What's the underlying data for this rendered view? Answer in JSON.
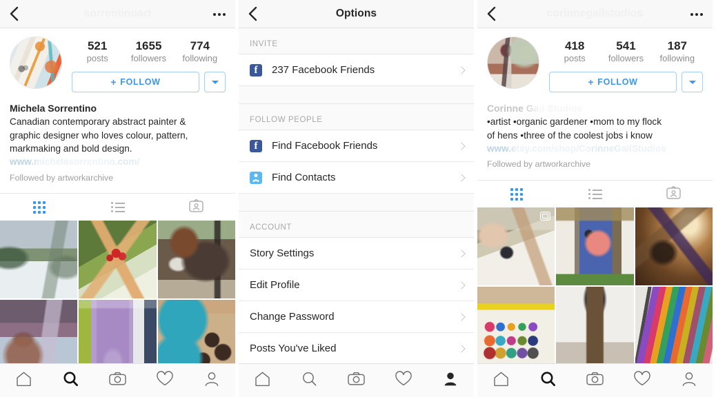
{
  "panels": {
    "left_profile": {
      "nav": {
        "back_icon": "back-chevron-icon",
        "username": "sorrentinoart",
        "username_visible_prefix": "sorre",
        "username_visible_suffix": "rt",
        "more_icon": "more-options-icon"
      },
      "avatar": "profile-avatar-abstract-painting",
      "stats": [
        {
          "num": "521",
          "label": "posts"
        },
        {
          "num": "1655",
          "label": "followers"
        },
        {
          "num": "774",
          "label": "following"
        }
      ],
      "follow_button": "FOLLOW",
      "follow_plus": "+",
      "dropdown_icon": "chevron-down-icon",
      "full_name": "Michela Sorrentino",
      "bio": "Canadian contemporary abstract painter &\ngraphic designer who loves colour, pattern,\nmarkmaking and bold design.",
      "website": "www.michelasorrentino.com/",
      "website_visible_prefix": "www",
      "website_visible_suffix": ".com/",
      "followed_by": "Followed by artworkarchive",
      "tabs": [
        {
          "name": "grid-tab",
          "icon": "grid-icon",
          "active": true
        },
        {
          "name": "list-tab",
          "icon": "list-icon",
          "active": false
        },
        {
          "name": "tagged-tab",
          "icon": "tagged-photos-icon",
          "active": false
        }
      ],
      "photos": [
        "snowy-forest-landscape",
        "holly-berries-on-plate",
        "horse-in-blanket",
        "winter-sunset-scene",
        "framed-artwork-by-door",
        "chocolate-cupcakes-on-teal-plates"
      ],
      "bottom_nav": [
        {
          "name": "home-tab",
          "icon": "home-icon",
          "active": false
        },
        {
          "name": "search-tab",
          "icon": "search-icon",
          "active": true
        },
        {
          "name": "camera-tab",
          "icon": "camera-icon",
          "active": false
        },
        {
          "name": "activity-tab",
          "icon": "heart-icon",
          "active": false
        },
        {
          "name": "profile-tab",
          "icon": "person-icon",
          "active": false
        }
      ]
    },
    "middle_options": {
      "nav": {
        "back_icon": "back-chevron-icon",
        "title": "Options"
      },
      "sections": [
        {
          "header": "INVITE",
          "rows": [
            {
              "label": "237 Facebook Friends",
              "icon": "facebook-icon"
            }
          ]
        },
        {
          "header": "FOLLOW PEOPLE",
          "rows": [
            {
              "label": "Find Facebook Friends",
              "icon": "facebook-icon"
            },
            {
              "label": "Find Contacts",
              "icon": "contacts-icon"
            }
          ]
        },
        {
          "header": "ACCOUNT",
          "rows": [
            {
              "label": "Story Settings",
              "icon": ""
            },
            {
              "label": "Edit Profile",
              "icon": ""
            },
            {
              "label": "Change Password",
              "icon": ""
            },
            {
              "label": "Posts You've Liked",
              "icon": ""
            }
          ]
        }
      ],
      "bottom_nav": [
        {
          "name": "home-tab",
          "icon": "home-icon",
          "active": false
        },
        {
          "name": "search-tab",
          "icon": "search-icon",
          "active": false
        },
        {
          "name": "camera-tab",
          "icon": "camera-icon",
          "active": false
        },
        {
          "name": "activity-tab",
          "icon": "heart-icon",
          "active": false
        },
        {
          "name": "profile-tab",
          "icon": "person-icon",
          "active": true
        }
      ]
    },
    "right_profile": {
      "nav": {
        "back_icon": "back-chevron-icon",
        "username": "corinnegailstudios",
        "username_visible_prefix": "cori",
        "username_visible_suffix": "udios",
        "more_icon": "more-options-icon"
      },
      "avatar": "profile-avatar-person-by-mural",
      "stats": [
        {
          "num": "418",
          "label": "posts"
        },
        {
          "num": "541",
          "label": "followers"
        },
        {
          "num": "187",
          "label": "following"
        }
      ],
      "follow_button": "FOLLOW",
      "follow_plus": "+",
      "dropdown_icon": "chevron-down-icon",
      "full_name": "Corinne Gail Studios",
      "full_name_visible_prefix": "Cori",
      "full_name_visible_suffix": "s",
      "bio": "•artist •organic gardener •mom to my flock\nof hens •three of the coolest jobs i know",
      "website": "www.etsy.com/shop/CorinneGailStudios",
      "website_visible_prefix": "www",
      "website_visible_mid": "/CorinneGail",
      "website_visible_suffix": "udios",
      "followed_by": "Followed by artworkarchive",
      "tabs": [
        {
          "name": "grid-tab",
          "icon": "grid-icon",
          "active": true
        },
        {
          "name": "list-tab",
          "icon": "list-icon",
          "active": false
        },
        {
          "name": "tagged-tab",
          "icon": "tagged-photos-icon",
          "active": false
        }
      ],
      "photos": [
        "artist-hands-with-paint-supplies",
        "flamingo-painting-on-wood",
        "dried-thistle-flowers",
        "colorful-paint-palette",
        "painted-tall-object",
        "box-of-soft-pastels"
      ],
      "bottom_nav": [
        {
          "name": "home-tab",
          "icon": "home-icon",
          "active": false
        },
        {
          "name": "search-tab",
          "icon": "search-icon",
          "active": true
        },
        {
          "name": "camera-tab",
          "icon": "camera-icon",
          "active": false
        },
        {
          "name": "activity-tab",
          "icon": "heart-icon",
          "active": false
        },
        {
          "name": "profile-tab",
          "icon": "person-icon",
          "active": false
        }
      ]
    }
  },
  "colors": {
    "accent_blue": "#3897f0",
    "link_blue": "#00376b",
    "facebook_blue": "#3b5998",
    "contacts_blue": "#5bb9f0",
    "text_primary": "#262626",
    "text_secondary": "#8e8e8e"
  }
}
